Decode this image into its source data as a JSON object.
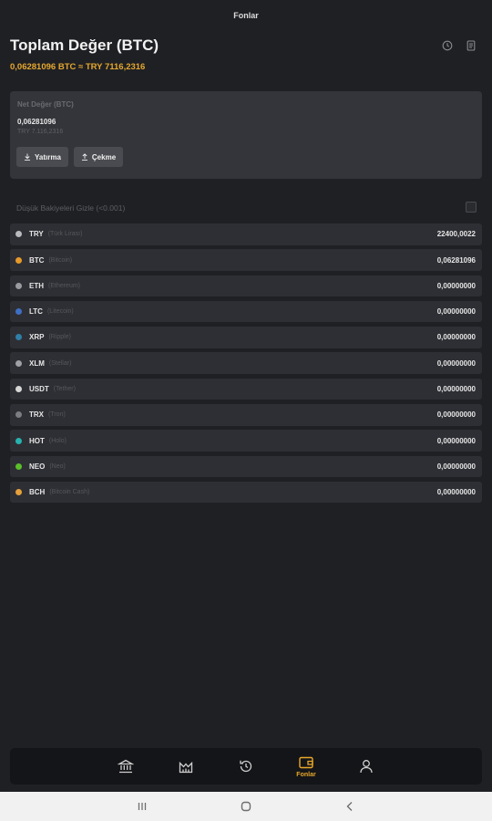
{
  "topbar": {
    "title": "Fonlar"
  },
  "header": {
    "title": "Toplam Değer (BTC)",
    "subtitle": "0,06281096 BTC ≈ TRY 7116,2316",
    "icons": [
      "history-icon",
      "document-icon"
    ]
  },
  "net_card": {
    "label": "Net Değer (BTC)",
    "btc_value": "0,06281096",
    "try_value": "TRY 7.116,2316",
    "deposit_label": "Yatırma",
    "withdraw_label": "Çekme"
  },
  "filter": {
    "label": "Düşük Bakiyeleri Gizle (<0.001)",
    "checked": false
  },
  "assets": [
    {
      "symbol": "TRY",
      "name": "(Türk Lirası)",
      "balance": "22400,0022",
      "color": "#b9babd"
    },
    {
      "symbol": "BTC",
      "name": "(Bitcoin)",
      "balance": "0,06281096",
      "color": "#e79a2a"
    },
    {
      "symbol": "ETH",
      "name": "(Ethereum)",
      "balance": "0,00000000",
      "color": "#9a9ba0"
    },
    {
      "symbol": "LTC",
      "name": "(Litecoin)",
      "balance": "0,00000000",
      "color": "#3f6fc4"
    },
    {
      "symbol": "XRP",
      "name": "(Ripple)",
      "balance": "0,00000000",
      "color": "#2f7fa8"
    },
    {
      "symbol": "XLM",
      "name": "(Stellar)",
      "balance": "0,00000000",
      "color": "#9fa0a5"
    },
    {
      "symbol": "USDT",
      "name": "(Tether)",
      "balance": "0,00000000",
      "color": "#d8d8d8"
    },
    {
      "symbol": "TRX",
      "name": "(Tron)",
      "balance": "0,00000000",
      "color": "#7c7d82"
    },
    {
      "symbol": "HOT",
      "name": "(Holo)",
      "balance": "0,00000000",
      "color": "#27b3b0"
    },
    {
      "symbol": "NEO",
      "name": "(Neo)",
      "balance": "0,00000000",
      "color": "#5bbf2a"
    },
    {
      "symbol": "BCH",
      "name": "(Bitcoin Cash)",
      "balance": "0,00000000",
      "color": "#e6a13a"
    }
  ],
  "bottom_nav": {
    "items": [
      {
        "icon": "bank-icon"
      },
      {
        "icon": "market-chart-icon"
      },
      {
        "icon": "history-icon"
      },
      {
        "icon": "wallet-icon",
        "label": "Fonlar",
        "active": true
      },
      {
        "icon": "profile-icon"
      }
    ]
  },
  "system_nav": {
    "icons": [
      "recents-icon",
      "home-icon",
      "back-icon"
    ]
  },
  "colors": {
    "accent": "#e8a82a",
    "background": "#1f2024",
    "card": "#34353a",
    "row": "#2e2f34"
  }
}
